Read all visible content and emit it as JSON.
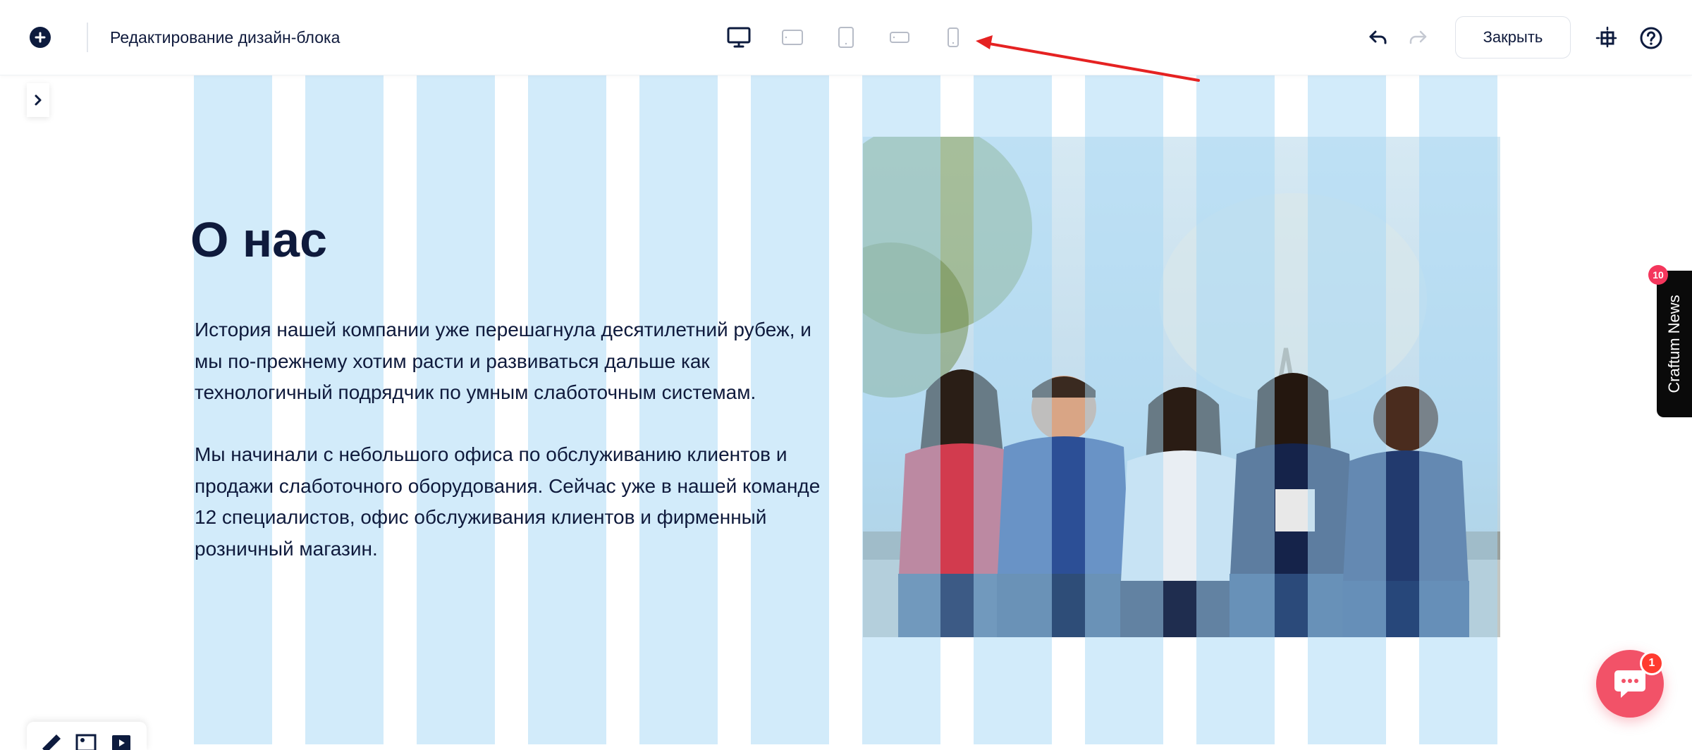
{
  "header": {
    "title": "Редактирование дизайн-блока",
    "close_label": "Закрыть"
  },
  "devices": [
    "desktop-icon",
    "tablet-landscape-icon",
    "tablet-portrait-icon",
    "phone-landscape-icon",
    "phone-portrait-icon"
  ],
  "content": {
    "heading": "О нас",
    "paragraph_1": "История нашей компании уже перешагнула десятилетний рубеж, и мы по-прежнему хотим расти и развиваться дальше как технологичный подрядчик по умным слаботочным системам.",
    "paragraph_2": "Мы начинали с небольшого офиса по обслуживанию клиентов и продажи слаботочного оборудования. Сейчас уже в нашей команде 12 специалистов, офис обслуживания клиентов и фирменный розничный магазин."
  },
  "news_tab": {
    "label": "Craftum News",
    "badge": "10"
  },
  "chat": {
    "badge": "1"
  },
  "colors": {
    "accent": "#0d1b3e",
    "grid": "#a5d7f5",
    "arrow": "#e52222",
    "chat": "#f25268"
  }
}
